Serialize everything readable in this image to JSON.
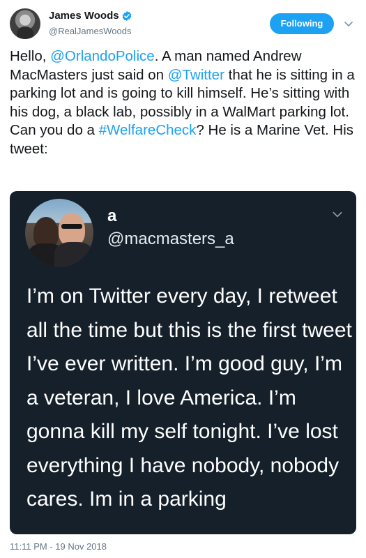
{
  "author": {
    "display_name": "James Woods",
    "handle": "@RealJamesWoods",
    "verified": true
  },
  "follow_button": {
    "label": "Following"
  },
  "tweet": {
    "segments": [
      {
        "text": "Hello, ",
        "link": false
      },
      {
        "text": "@OrlandoPolice",
        "link": true
      },
      {
        "text": ". A man named Andrew MacMasters just said on ",
        "link": false
      },
      {
        "text": "@Twitter",
        "link": true
      },
      {
        "text": " that he is sitting in a parking lot and is going to kill himself. He’s sitting with his dog, a black lab, possibly in a WalMart parking lot. Can you do a ",
        "link": false
      },
      {
        "text": "#WelfareCheck",
        "link": true
      },
      {
        "text": "? He is a Marine Vet. His tweet:",
        "link": false
      }
    ]
  },
  "quoted_tweet": {
    "name": "a",
    "handle": "@macmasters_a",
    "text": "I’m on Twitter every day, I retweet all the time but this is the first tweet I’ve ever written. I’m good guy, I’m a veteran, I love America. I’m gonna kill my self tonight. I’ve lost everything I have nobody, nobody cares. Im in a parking"
  },
  "timestamp": "11:11 PM - 19 Nov 2018",
  "colors": {
    "link": "#1da1f2",
    "follow_button_bg": "#1da1f2",
    "quote_bg": "#15202b",
    "secondary_text": "#657786"
  },
  "icons": {
    "verified": "verified-badge-icon",
    "caret": "chevron-down-icon"
  }
}
